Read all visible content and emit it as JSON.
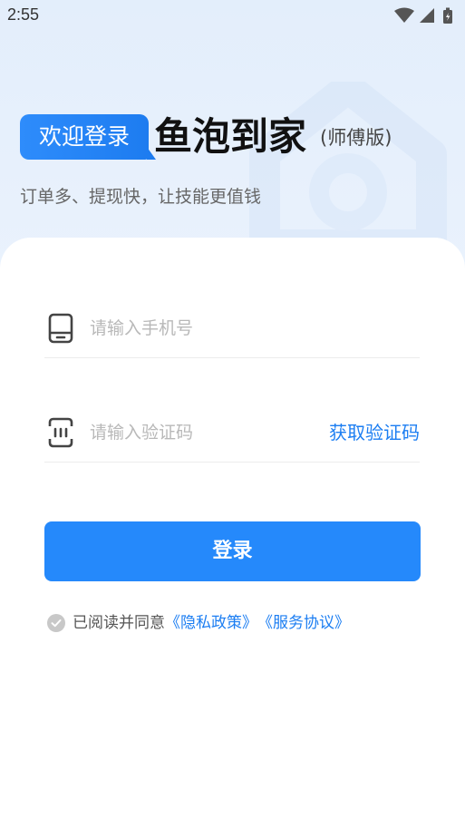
{
  "status_bar": {
    "time": "2:55",
    "icons": [
      "wifi-icon",
      "signal-icon",
      "battery-icon"
    ]
  },
  "header": {
    "welcome_badge": "欢迎登录",
    "app_name": "鱼泡到家",
    "edition": "(师傅版)",
    "slogan": "订单多、提现快，让技能更值钱"
  },
  "form": {
    "phone": {
      "value": "",
      "placeholder": "请输入手机号",
      "icon": "phone-icon"
    },
    "code": {
      "value": "",
      "placeholder": "请输入验证码",
      "icon": "sms-code-icon"
    },
    "get_code_label": "获取验证码",
    "login_label": "登录"
  },
  "agreement": {
    "checked": false,
    "prefix": "已阅读并同意",
    "privacy_link": "《隐私政策》",
    "service_link": "《服务协议》"
  },
  "colors": {
    "accent": "#2589fb",
    "link": "#1c7ef2",
    "background": "#e3eefb"
  }
}
